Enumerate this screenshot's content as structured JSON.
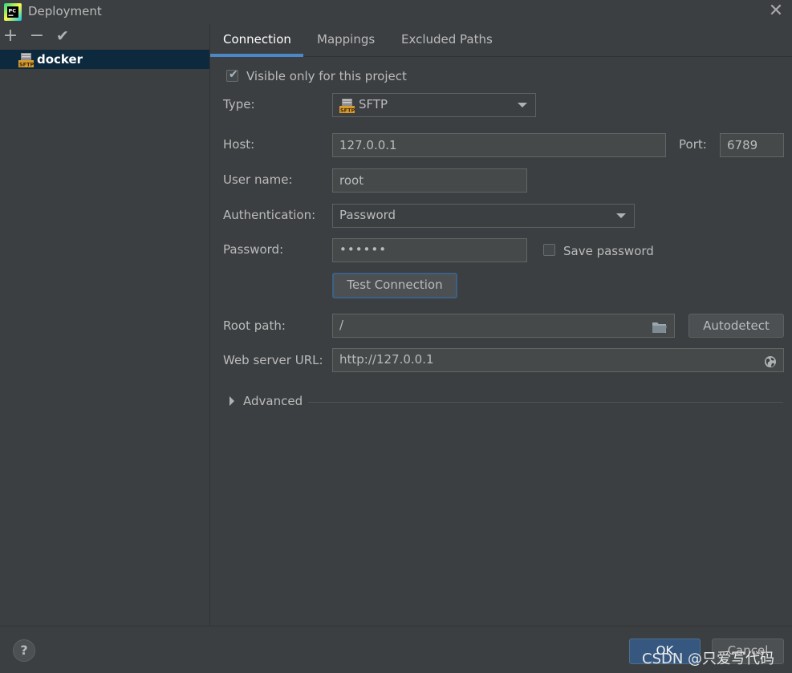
{
  "window": {
    "title": "Deployment",
    "app_icon": "pycharm-icon"
  },
  "left_toolbar": {
    "add": "+",
    "remove": "−",
    "apply": "✔"
  },
  "servers": [
    {
      "name": "docker",
      "icon": "sftp-icon"
    }
  ],
  "tabs": [
    {
      "label": "Connection",
      "active": true
    },
    {
      "label": "Mappings"
    },
    {
      "label": "Excluded Paths"
    }
  ],
  "connection": {
    "visible_only": {
      "label": "Visible only for this project",
      "checked": true
    },
    "type": {
      "label": "Type:",
      "value": "SFTP",
      "icon_text": "SFTP"
    },
    "host": {
      "label": "Host:",
      "value": "127.0.0.1"
    },
    "port": {
      "label": "Port:",
      "value": "6789"
    },
    "username": {
      "label": "User name:",
      "value": "root"
    },
    "authentication": {
      "label": "Authentication:",
      "value": "Password"
    },
    "password": {
      "label": "Password:",
      "masked": "••••••"
    },
    "save_password": {
      "label": "Save password",
      "checked": false
    },
    "test_connection": "Test Connection",
    "root_path": {
      "label": "Root path:",
      "value": "/"
    },
    "autodetect": "Autodetect",
    "web_server_url": {
      "label": "Web server URL:",
      "value": "http://127.0.0.1"
    },
    "advanced": "Advanced"
  },
  "footer": {
    "help": "?",
    "ok": "OK",
    "cancel": "Cancel",
    "watermark": "CSDN @只爱写代码"
  },
  "colors": {
    "accent": "#4a88c7",
    "selection": "#0d293e",
    "primary_button": "#365880"
  }
}
